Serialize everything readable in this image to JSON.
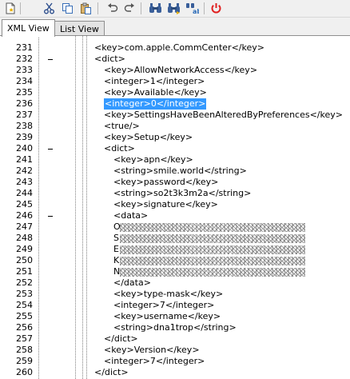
{
  "tabs": [
    {
      "label": "XML View",
      "active": true
    },
    {
      "label": "List View",
      "active": false
    }
  ],
  "lines": [
    {
      "n": "231",
      "depth": 0,
      "fold": false,
      "text": "<key>com.apple.CommCenter</key>"
    },
    {
      "n": "232",
      "depth": 0,
      "fold": true,
      "text": "<dict>"
    },
    {
      "n": "233",
      "depth": 1,
      "fold": false,
      "text": "<key>AllowNetworkAccess</key>"
    },
    {
      "n": "234",
      "depth": 1,
      "fold": false,
      "text": "<integer>1</integer>"
    },
    {
      "n": "235",
      "depth": 1,
      "fold": false,
      "text": "<key>Available</key>"
    },
    {
      "n": "236",
      "depth": 1,
      "fold": false,
      "text": "<integer>0</integer>",
      "highlight": true
    },
    {
      "n": "237",
      "depth": 1,
      "fold": false,
      "text": "<key>SettingsHaveBeenAlteredByPreferences</key>"
    },
    {
      "n": "238",
      "depth": 1,
      "fold": false,
      "text": "<true/>"
    },
    {
      "n": "239",
      "depth": 1,
      "fold": false,
      "text": "<key>Setup</key>"
    },
    {
      "n": "240",
      "depth": 1,
      "fold": true,
      "text": "<dict>"
    },
    {
      "n": "241",
      "depth": 2,
      "fold": false,
      "text": "<key>apn</key>"
    },
    {
      "n": "242",
      "depth": 2,
      "fold": false,
      "text": "<string>smile.world</string>"
    },
    {
      "n": "243",
      "depth": 2,
      "fold": false,
      "text": "<key>password</key>"
    },
    {
      "n": "244",
      "depth": 2,
      "fold": false,
      "text": "<string>so2t3k3m2a</string>"
    },
    {
      "n": "245",
      "depth": 2,
      "fold": false,
      "text": "<key>signature</key>"
    },
    {
      "n": "246",
      "depth": 2,
      "fold": true,
      "text": "<data>"
    },
    {
      "n": "247",
      "depth": 2,
      "fold": false,
      "text": "O",
      "obscured": true
    },
    {
      "n": "248",
      "depth": 2,
      "fold": false,
      "text": "S",
      "obscured": true
    },
    {
      "n": "249",
      "depth": 2,
      "fold": false,
      "text": "E",
      "obscured": true
    },
    {
      "n": "250",
      "depth": 2,
      "fold": false,
      "text": "K",
      "obscured": true
    },
    {
      "n": "251",
      "depth": 2,
      "fold": false,
      "text": "N",
      "obscured": true
    },
    {
      "n": "252",
      "depth": 2,
      "fold": false,
      "text": "</data>"
    },
    {
      "n": "253",
      "depth": 2,
      "fold": false,
      "text": "<key>type-mask</key>"
    },
    {
      "n": "254",
      "depth": 2,
      "fold": false,
      "text": "<integer>7</integer>"
    },
    {
      "n": "255",
      "depth": 2,
      "fold": false,
      "text": "<key>username</key>"
    },
    {
      "n": "256",
      "depth": 2,
      "fold": false,
      "text": "<string>dna1trop</string>"
    },
    {
      "n": "257",
      "depth": 1,
      "fold": false,
      "text": "</dict>"
    },
    {
      "n": "258",
      "depth": 1,
      "fold": false,
      "text": "<key>Version</key>"
    },
    {
      "n": "259",
      "depth": 1,
      "fold": false,
      "text": "<integer>7</integer>"
    },
    {
      "n": "260",
      "depth": 0,
      "fold": false,
      "text": "</dict>"
    }
  ],
  "toolbar": {
    "icons": [
      "new-document-icon",
      "cut-icon",
      "copy-icon",
      "paste-icon",
      "undo-icon",
      "redo-icon",
      "find-icon",
      "find-next-icon",
      "replace-icon",
      "power-icon"
    ]
  },
  "colors": {
    "selection": "#3399ff",
    "power": "#e02020"
  }
}
